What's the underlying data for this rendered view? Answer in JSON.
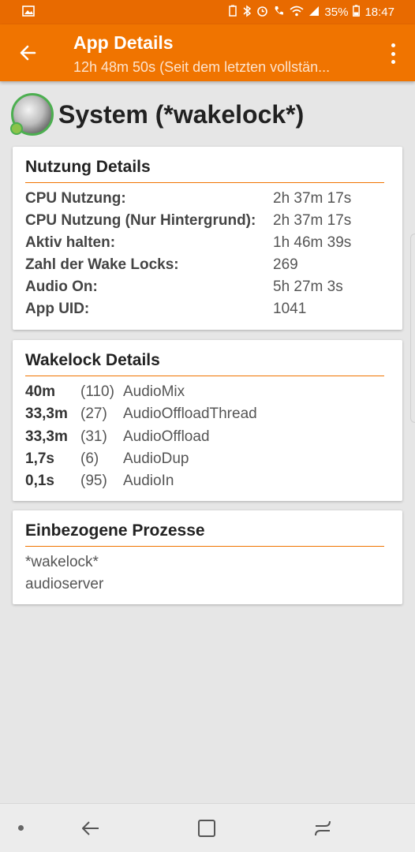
{
  "status_bar": {
    "battery": "35%",
    "time": "18:47"
  },
  "app_bar": {
    "title": "App Details",
    "subtitle": "12h 48m 50s (Seit dem letzten vollstän..."
  },
  "app": {
    "name": "System (*wakelock*)"
  },
  "usage": {
    "title": "Nutzung Details",
    "rows": [
      {
        "label": "CPU Nutzung:",
        "value": "2h 37m 17s"
      },
      {
        "label": "CPU Nutzung (Nur Hintergrund):",
        "value": "2h 37m 17s"
      },
      {
        "label": "Aktiv halten:",
        "value": "1h 46m 39s"
      },
      {
        "label": "Zahl der Wake Locks:",
        "value": "269"
      },
      {
        "label": "Audio On:",
        "value": "5h 27m 3s"
      },
      {
        "label": "App UID:",
        "value": "1041"
      }
    ]
  },
  "wakelocks": {
    "title": "Wakelock Details",
    "rows": [
      {
        "time": "40m",
        "count": "(110)",
        "name": "AudioMix"
      },
      {
        "time": "33,3m",
        "count": "(27)",
        "name": "AudioOffloadThread"
      },
      {
        "time": "33,3m",
        "count": "(31)",
        "name": "AudioOffload"
      },
      {
        "time": "1,7s",
        "count": "(6)",
        "name": "AudioDup"
      },
      {
        "time": "0,1s",
        "count": "(95)",
        "name": "AudioIn"
      }
    ]
  },
  "processes": {
    "title": "Einbezogene Prozesse",
    "items": [
      "*wakelock*",
      "audioserver"
    ]
  },
  "colors": {
    "accent": "#f07400",
    "status_bar": "#e86a00"
  }
}
